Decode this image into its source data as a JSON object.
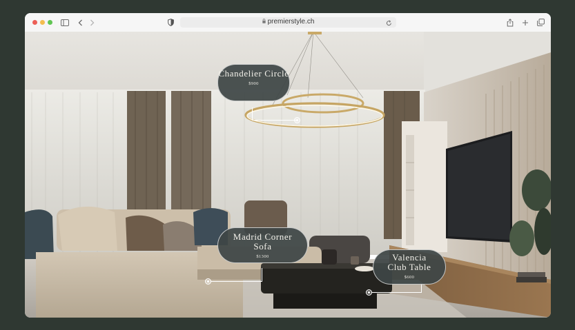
{
  "browser": {
    "url": "premierstyle.ch"
  },
  "hotspots": [
    {
      "name": "Chandelier Circle",
      "price": "$900"
    },
    {
      "name": "Madrid Corner Sofa",
      "price": "$1300"
    },
    {
      "name": "Valencia Club Table",
      "price": "$600"
    }
  ]
}
